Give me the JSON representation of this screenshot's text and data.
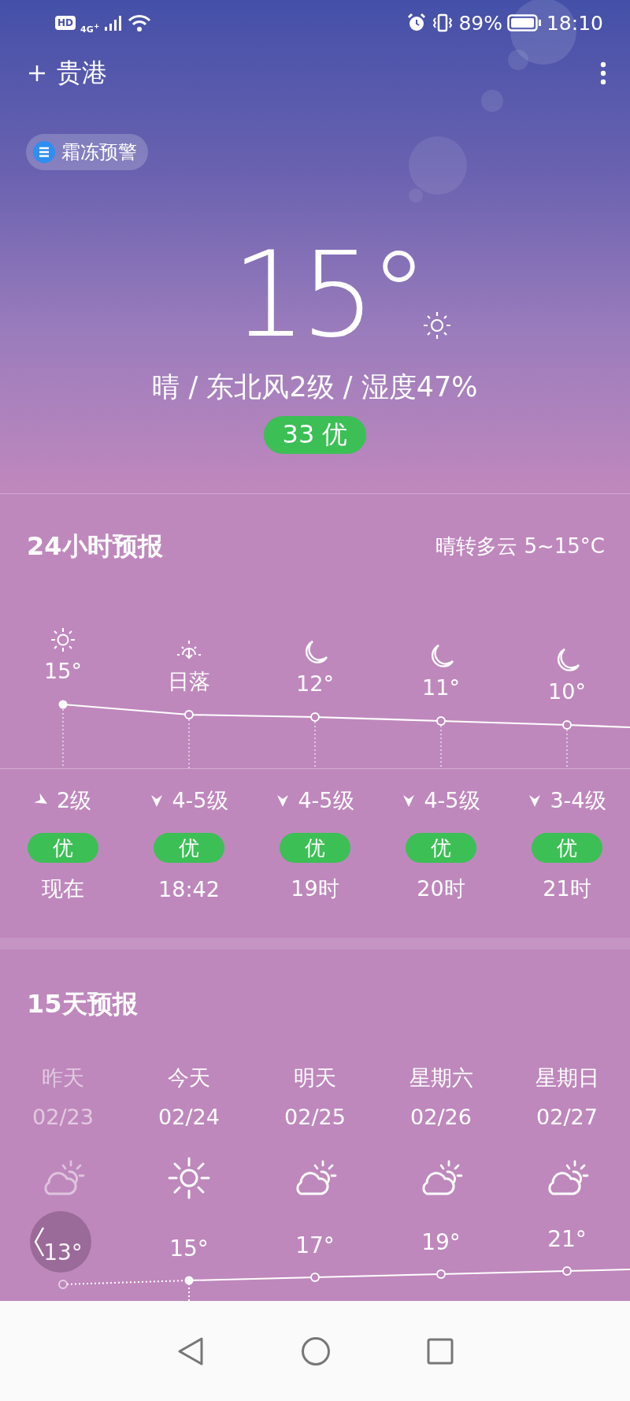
{
  "status_bar": {
    "hd_badge": "HD",
    "network": "4G$^{+}$",
    "battery_text": "89%",
    "time": "18:10"
  },
  "location": {
    "name": "贵港"
  },
  "alert": {
    "label": "霜冻预警"
  },
  "current": {
    "temperature": "15°",
    "summary": "晴 / 东北风2级 / 湿度47%",
    "aqi": "33 优"
  },
  "hourly": {
    "title": "24小时预报",
    "summary": "晴转多云 5~15°C",
    "items": [
      {
        "kind": "sunny",
        "label": "15°",
        "wind": "2级",
        "aqi": "优",
        "time": "现在"
      },
      {
        "kind": "sunset",
        "label": "日落",
        "wind": "4-5级",
        "aqi": "优",
        "time": "18:42"
      },
      {
        "kind": "night",
        "label": "12°",
        "wind": "4-5级",
        "aqi": "优",
        "time": "19时"
      },
      {
        "kind": "night",
        "label": "11°",
        "wind": "4-5级",
        "aqi": "优",
        "time": "20时"
      },
      {
        "kind": "night",
        "label": "10°",
        "wind": "3-4级",
        "aqi": "优",
        "time": "21时"
      }
    ]
  },
  "daily": {
    "title": "15天预报",
    "items": [
      {
        "day": "昨天",
        "date": "02/23",
        "kind": "partly_cloudy",
        "high": "13°",
        "past": true
      },
      {
        "day": "今天",
        "date": "02/24",
        "kind": "sunny",
        "high": "15°",
        "past": false
      },
      {
        "day": "明天",
        "date": "02/25",
        "kind": "partly_cloudy",
        "high": "17°",
        "past": false
      },
      {
        "day": "星期六",
        "date": "02/26",
        "kind": "partly_cloudy",
        "high": "19°",
        "past": false
      },
      {
        "day": "星期日",
        "date": "02/27",
        "kind": "partly_cloudy",
        "high": "21°",
        "past": false
      }
    ]
  }
}
